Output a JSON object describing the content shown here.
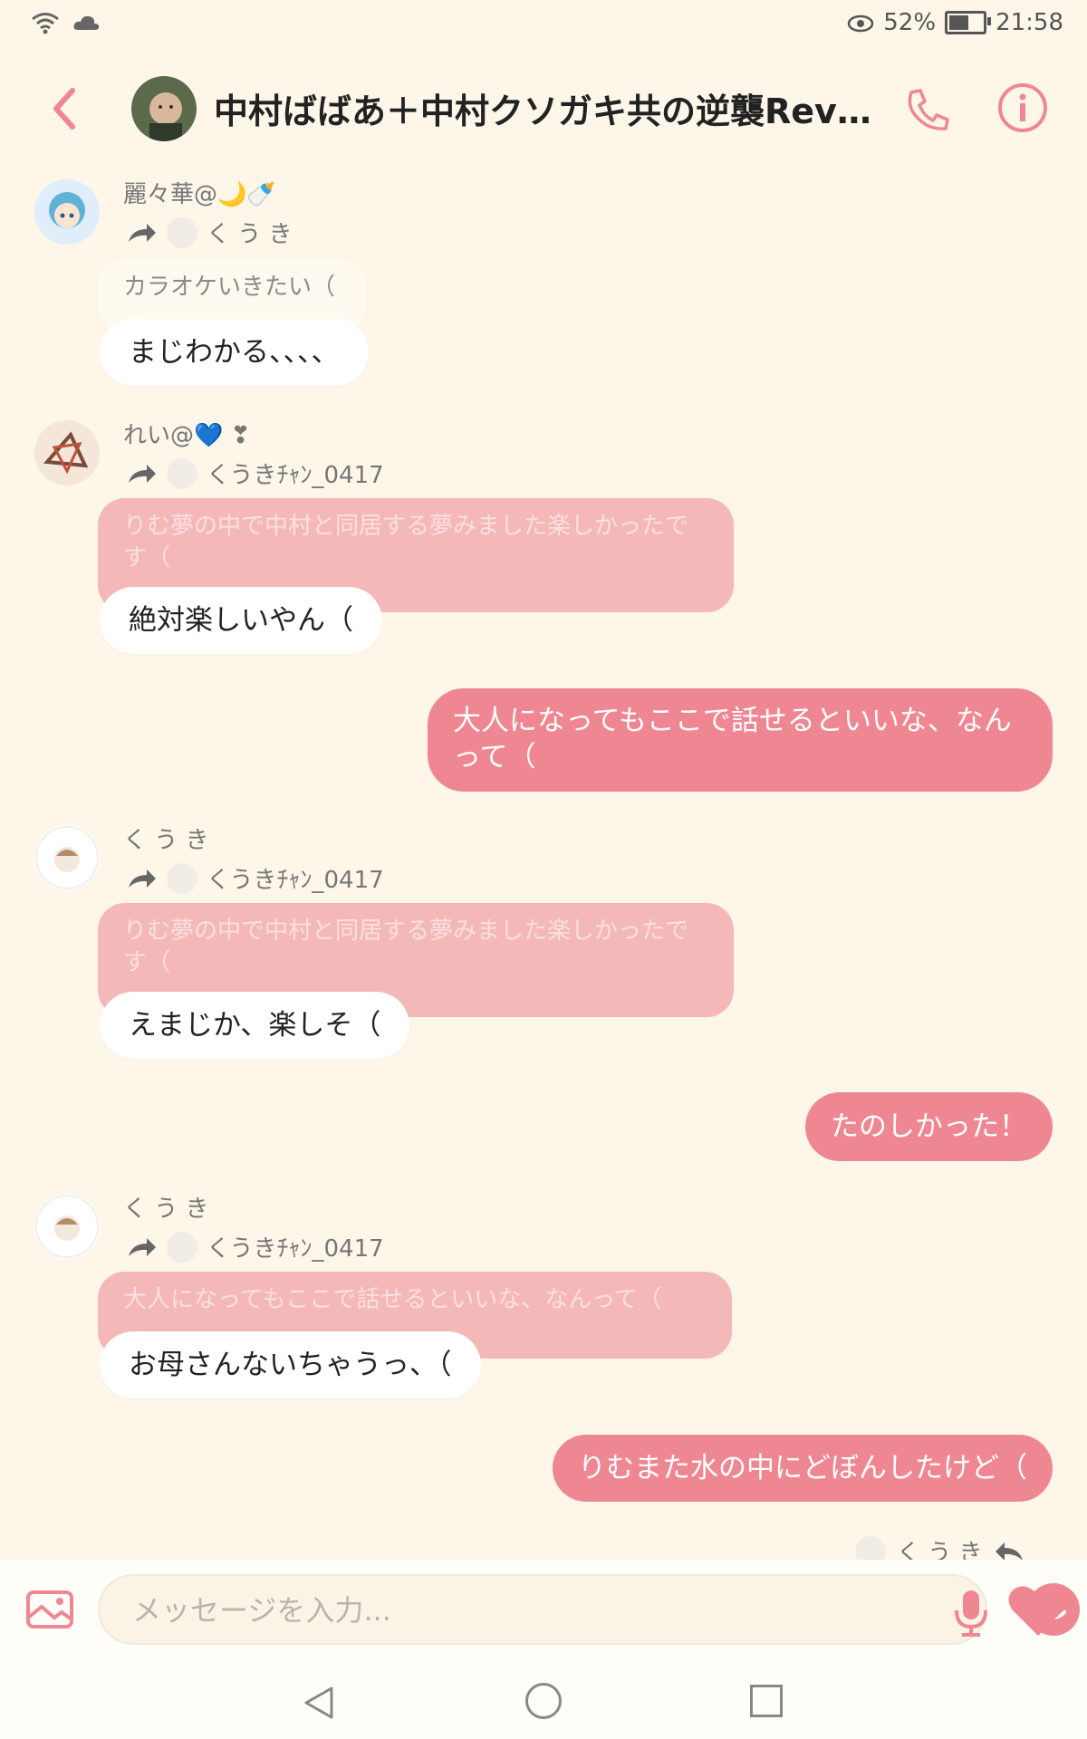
{
  "status_bar": {
    "battery": "52%",
    "time": "21:58"
  },
  "header": {
    "title": "中村ばばあ＋中村クソガキ共の逆襲Revo.."
  },
  "colors": {
    "accent": "#ef8793",
    "background": "#fdf6e9",
    "quote_pink": "#f5b8b8"
  },
  "messages": [
    {
      "sender": "麗々華@",
      "sender_emoji": "🌙🍼",
      "reply_to": "く う き",
      "quote": "カラオケいきたい（",
      "text": "まじわかる、、、、"
    },
    {
      "sender": "れい@",
      "sender_emoji": "💙 ❣",
      "reply_to": "くうきﾁｬﾝ_0417",
      "quote": "りむ夢の中で中村と同居する夢みました楽しかったです（",
      "text": "絶対楽しいやん（"
    },
    {
      "outgoing": "大人になってもここで話せるといいな、なんって（"
    },
    {
      "sender": "く う き",
      "reply_to": "くうきﾁｬﾝ_0417",
      "quote": "りむ夢の中で中村と同居する夢みました楽しかったです（",
      "text": "えまじか、楽しそ（"
    },
    {
      "outgoing": "たのしかった！"
    },
    {
      "sender": "く う き",
      "reply_to": "くうきﾁｬﾝ_0417",
      "quote": "大人になってもここで話せるといいな、なんって（",
      "text": "お母さんないちゃうっ、（"
    },
    {
      "outgoing": "りむまた水の中にどぼんしたけど（"
    }
  ],
  "partial_reply": {
    "name": "く う き"
  },
  "input": {
    "placeholder": "メッセージを入力..."
  }
}
